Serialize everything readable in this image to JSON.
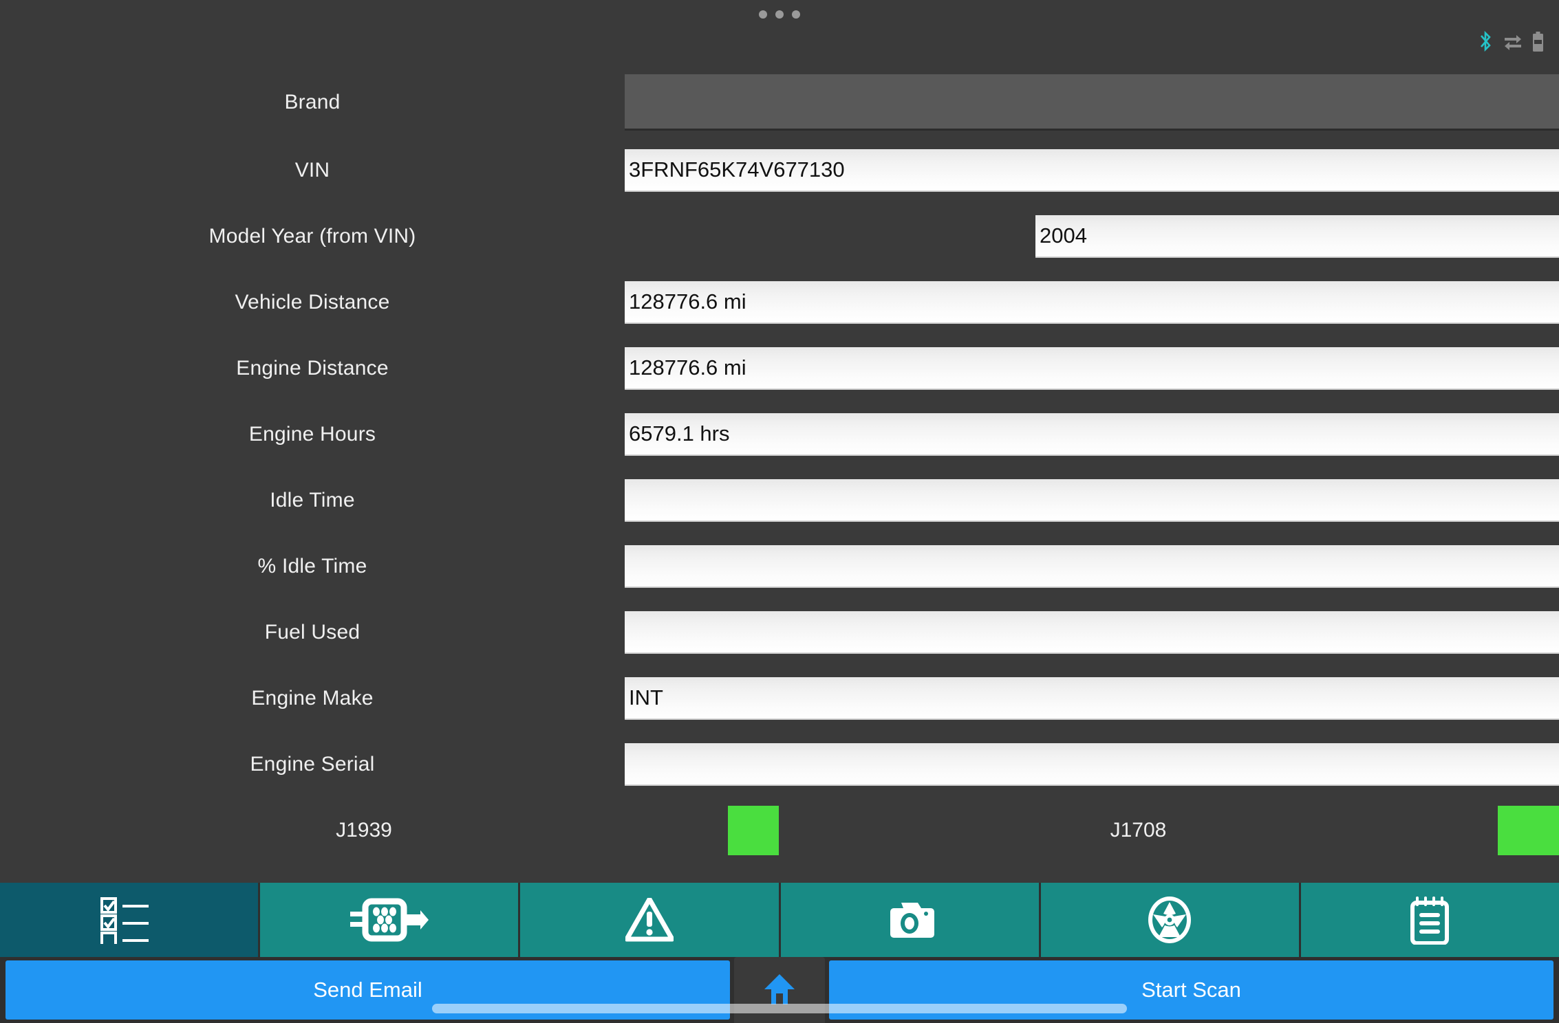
{
  "status_bar": {
    "menu_dots_icon": "more-horizontal-icon",
    "bluetooth_icon": "bluetooth-icon",
    "bluetooth_color": "#25c3c8",
    "data_transfer_icon": "data-transfer-icon",
    "battery_icon": "battery-icon"
  },
  "form": {
    "fields": [
      {
        "label": "Brand",
        "value": "",
        "type": "spinner"
      },
      {
        "label": "VIN",
        "value": "3FRNF65K74V677130",
        "type": "text"
      },
      {
        "label": "Model Year (from VIN)",
        "value": "2004",
        "type": "text"
      },
      {
        "label": "Vehicle Distance",
        "value": "128776.6 mi",
        "type": "text"
      },
      {
        "label": "Engine Distance",
        "value": "128776.6 mi",
        "type": "text"
      },
      {
        "label": "Engine Hours",
        "value": "6579.1 hrs",
        "type": "text"
      },
      {
        "label": "Idle Time",
        "value": "",
        "type": "text"
      },
      {
        "label": "% Idle Time",
        "value": "",
        "type": "text"
      },
      {
        "label": "Fuel Used",
        "value": "",
        "type": "text"
      },
      {
        "label": "Engine Make",
        "value": "INT",
        "type": "text"
      },
      {
        "label": "Engine Serial",
        "value": "",
        "type": "text"
      }
    ]
  },
  "protocols": {
    "j1939_label": "J1939",
    "j1939_status_color": "#4ade3f",
    "j1708_label": "J1708",
    "j1708_status_color": "#4ade3f"
  },
  "tabbar": {
    "active_color": "#0d5a6b",
    "inactive_color": "#188b85",
    "tabs": [
      {
        "name": "checklist",
        "icon": "checklist-icon",
        "active": true
      },
      {
        "name": "connector",
        "icon": "obd-connector-icon",
        "active": false
      },
      {
        "name": "faults",
        "icon": "warning-icon",
        "active": false
      },
      {
        "name": "photos",
        "icon": "camera-icon",
        "active": false
      },
      {
        "name": "tires",
        "icon": "wheel-icon",
        "active": false
      },
      {
        "name": "notes",
        "icon": "notepad-icon",
        "active": false
      }
    ]
  },
  "actions": {
    "send_email_label": "Send Email",
    "home_icon": "home-icon",
    "start_scan_label": "Start Scan",
    "button_color": "#2196f3"
  }
}
